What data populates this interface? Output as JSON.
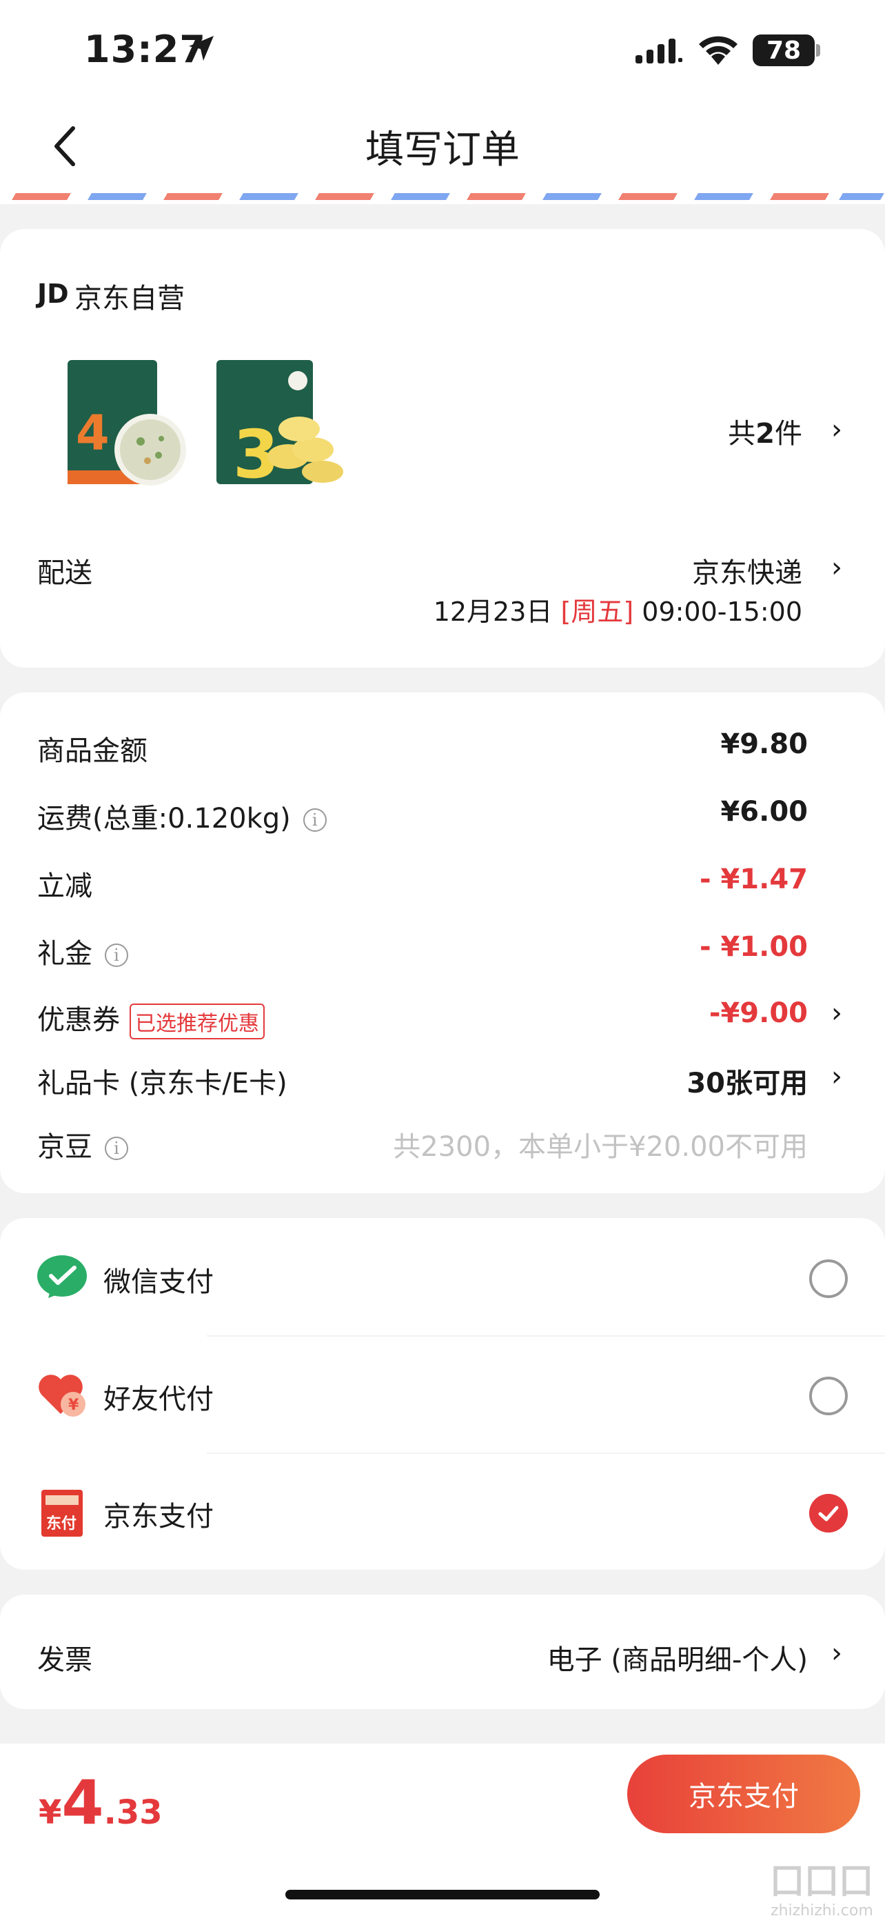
{
  "status_bar": {
    "time": "13:27",
    "battery": "78"
  },
  "nav": {
    "title": "填写订单"
  },
  "shop": {
    "logo": "JD",
    "name": "京东自营"
  },
  "goods": {
    "count_prefix": "共",
    "count": "2",
    "count_suffix": "件"
  },
  "delivery": {
    "label": "配送",
    "method": "京东快递",
    "date": "12月23日",
    "weekday": "[周五]",
    "time": "09:00-15:00"
  },
  "price": {
    "items": [
      {
        "label": "商品金额",
        "value": "¥9.80"
      },
      {
        "label": "运费(总重:0.120kg)",
        "value": "¥6.00"
      },
      {
        "label": "立减",
        "value": "- ¥1.47"
      },
      {
        "label": "礼金",
        "value": "- ¥1.00"
      },
      {
        "label": "优惠券",
        "badge": "已选推荐优惠",
        "value": "-¥9.00"
      },
      {
        "label": "礼品卡 (京东卡/E卡)",
        "value": "30张可用"
      },
      {
        "label": "京豆",
        "value": "共2300，本单小于¥20.00不可用"
      }
    ]
  },
  "payment": {
    "options": [
      {
        "label": "微信支付",
        "selected": false
      },
      {
        "label": "好友代付",
        "selected": false
      },
      {
        "label": "京东支付",
        "selected": true
      }
    ],
    "jd_pay_icon_text": "东付"
  },
  "invoice": {
    "label": "发票",
    "value": "电子 (商品明细-个人)"
  },
  "footer": {
    "currency": "¥",
    "amount_int": "4",
    "amount_dec": ".33",
    "submit_label": "京东支付",
    "watermark_url": "zhizhizhi.com"
  },
  "colors": {
    "accent": "#e4393c",
    "wechat": "#2aae67",
    "button_start": "#e8413a",
    "button_end": "#f07a43"
  }
}
